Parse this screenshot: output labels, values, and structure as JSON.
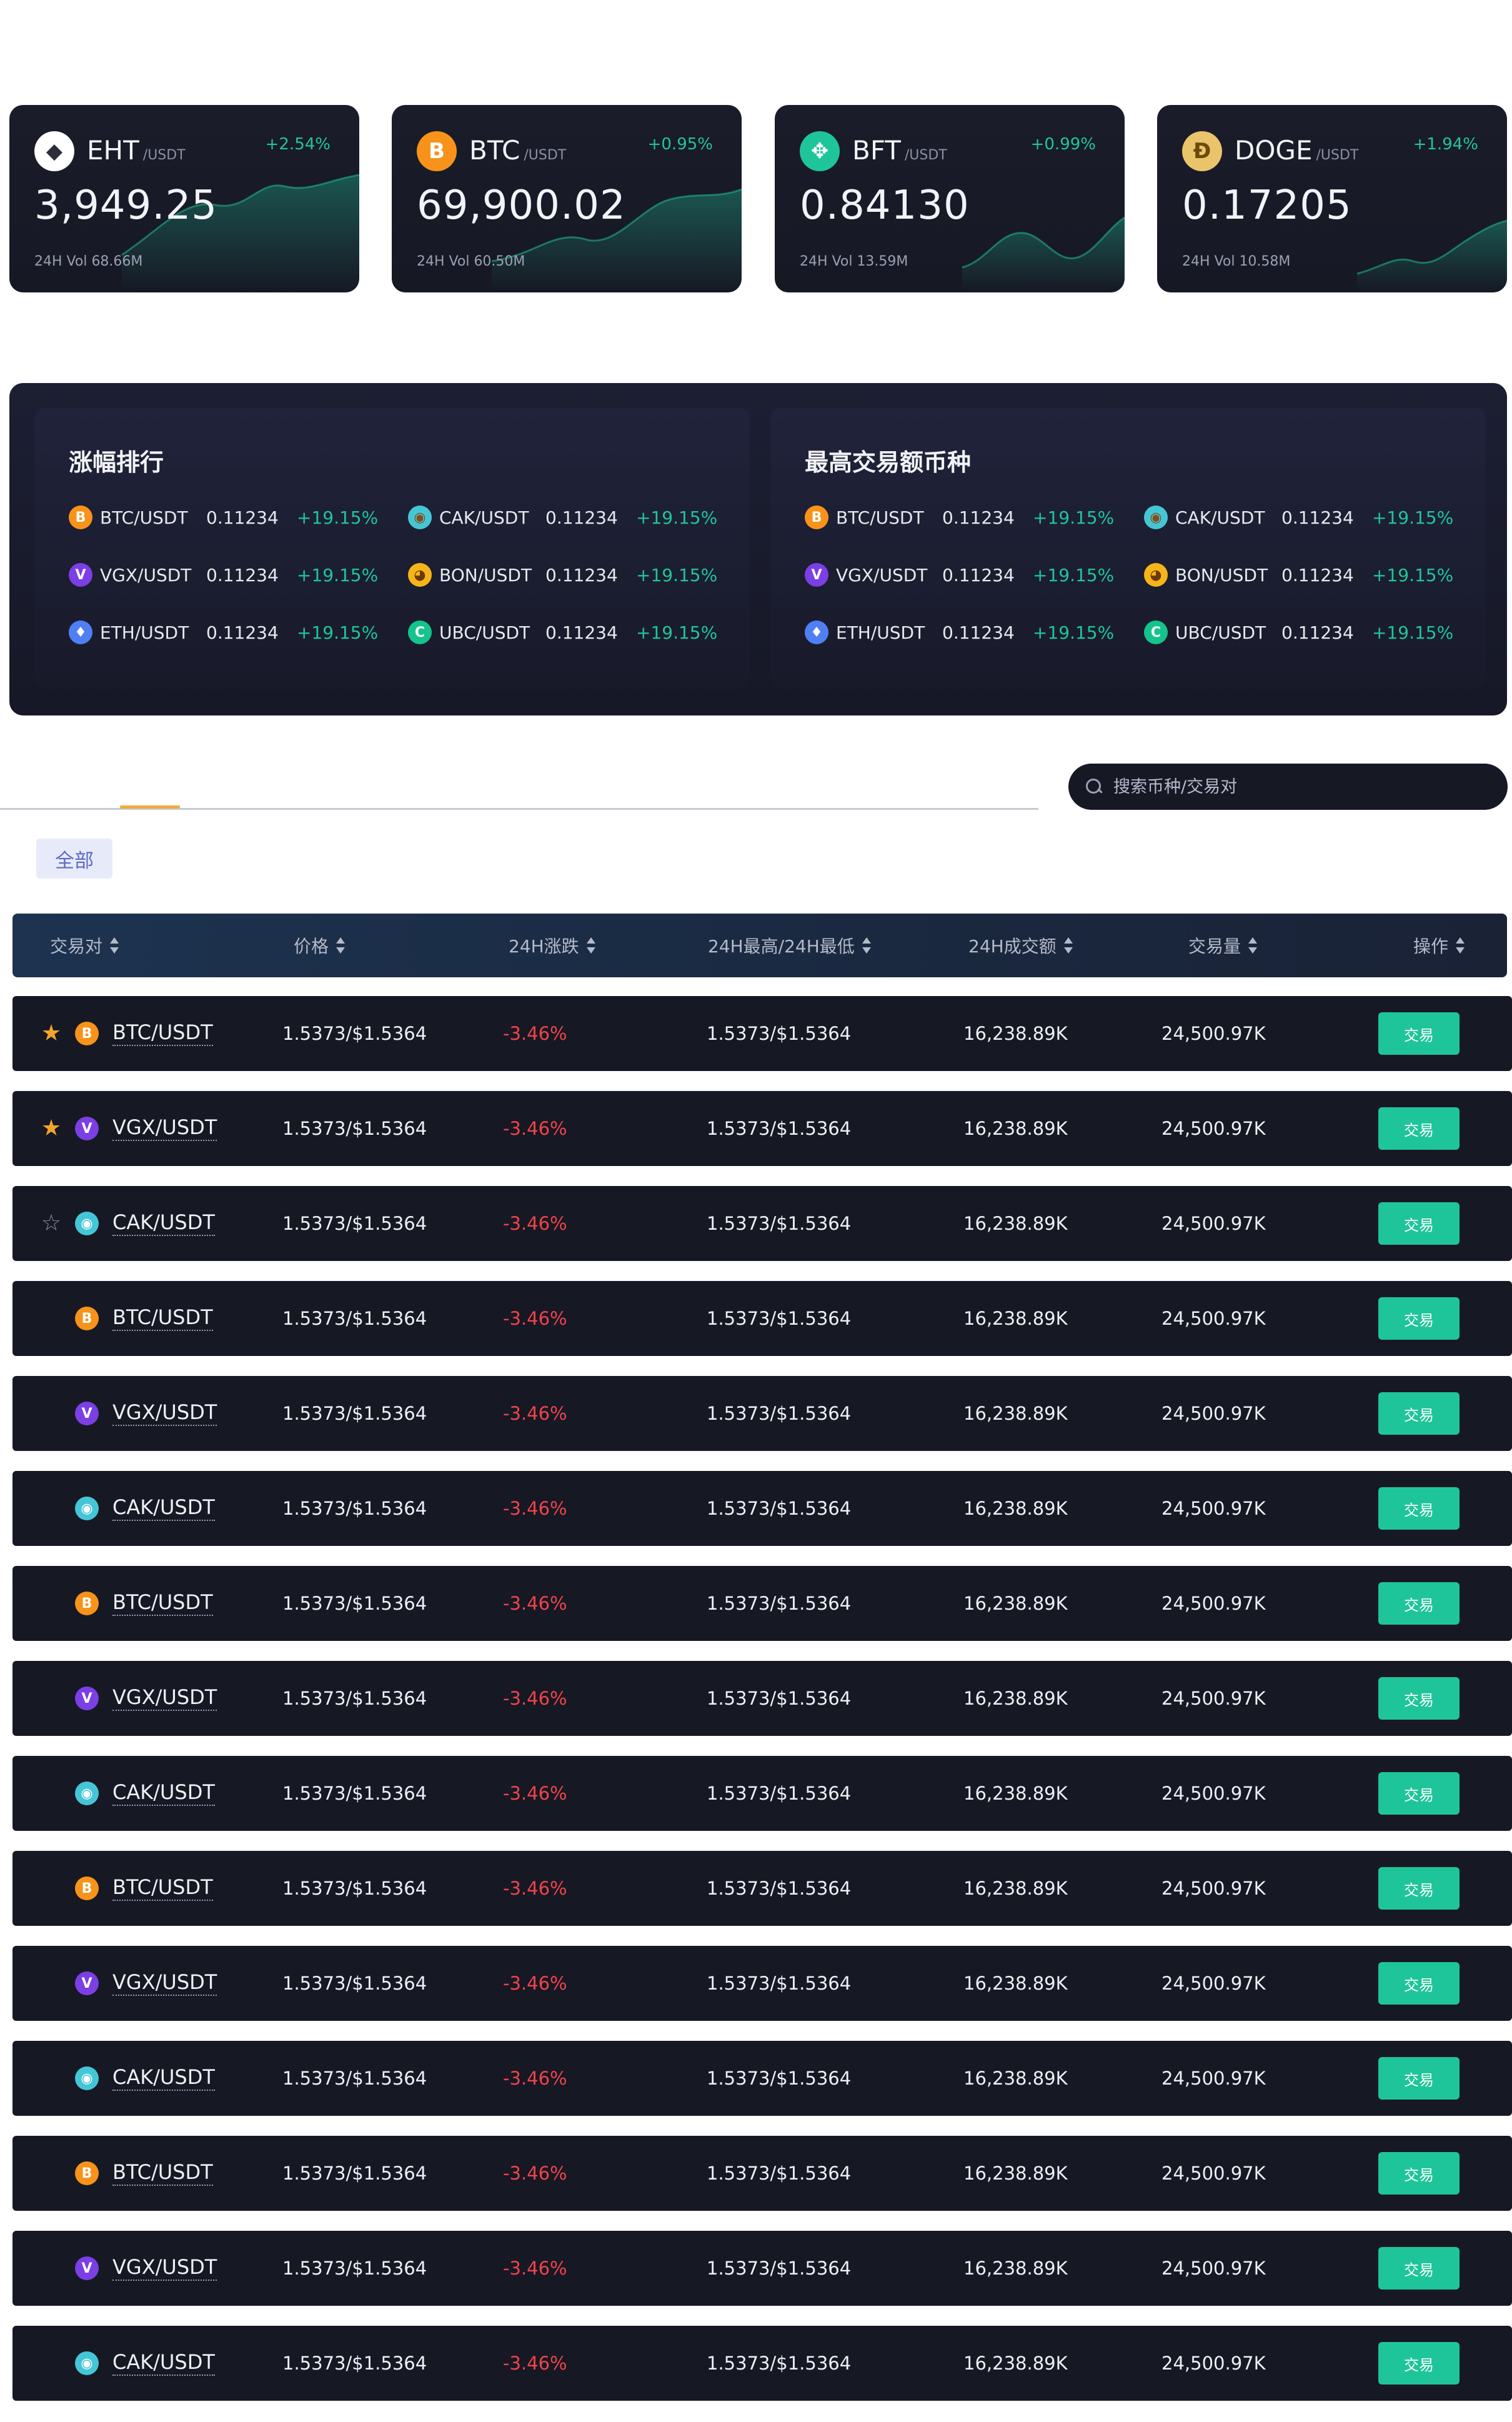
{
  "tickers": [
    {
      "symbol": "EHT",
      "quote": "/USDT",
      "change": "+2.54%",
      "price": "3,949.25",
      "volume": "24H Vol 68.66M",
      "icon": "ethereum-icon",
      "icon_glyph": "◆",
      "icon_bg": "#ffffff",
      "icon_fg": "#2b2d3a"
    },
    {
      "symbol": "BTC",
      "quote": "/USDT",
      "change": "+0.95%",
      "price": "69,900.02",
      "volume": "24H Vol 60.50M",
      "icon": "bitcoin-icon",
      "icon_glyph": "B",
      "icon_bg": "#f7931a",
      "icon_fg": "#ffffff"
    },
    {
      "symbol": "BFT",
      "quote": "/USDT",
      "change": "+0.99%",
      "price": "0.84130",
      "volume": "24H Vol 13.59M",
      "icon": "bft-icon",
      "icon_glyph": "✥",
      "icon_bg": "#1fc59a",
      "icon_fg": "#ffffff"
    },
    {
      "symbol": "DOGE",
      "quote": "/USDT",
      "change": "+1.94%",
      "price": "0.17205",
      "volume": "24H Vol 10.58M",
      "icon": "doge-icon",
      "icon_glyph": "Ð",
      "icon_bg": "#e9c46a",
      "icon_fg": "#6b4a0a"
    }
  ],
  "rankings": [
    {
      "title": "涨幅排行",
      "items": [
        {
          "pair": "BTC/USDT",
          "value": "0.11234",
          "change": "+19.15%",
          "coin": "btc",
          "glyph": "B"
        },
        {
          "pair": "CAK/USDT",
          "value": "0.11234",
          "change": "+19.15%",
          "coin": "cak",
          "glyph": "◉"
        },
        {
          "pair": "VGX/USDT",
          "value": "0.11234",
          "change": "+19.15%",
          "coin": "vgx",
          "glyph": "V"
        },
        {
          "pair": "BON/USDT",
          "value": "0.11234",
          "change": "+19.15%",
          "coin": "bon",
          "glyph": "◕"
        },
        {
          "pair": "ETH/USDT",
          "value": "0.11234",
          "change": "+19.15%",
          "coin": "eth",
          "glyph": "♦"
        },
        {
          "pair": "UBC/USDT",
          "value": "0.11234",
          "change": "+19.15%",
          "coin": "ubc",
          "glyph": "C"
        }
      ]
    },
    {
      "title": "最高交易额币种",
      "items": [
        {
          "pair": "BTC/USDT",
          "value": "0.11234",
          "change": "+19.15%",
          "coin": "btc",
          "glyph": "B"
        },
        {
          "pair": "CAK/USDT",
          "value": "0.11234",
          "change": "+19.15%",
          "coin": "cak",
          "glyph": "◉"
        },
        {
          "pair": "VGX/USDT",
          "value": "0.11234",
          "change": "+19.15%",
          "coin": "vgx",
          "glyph": "V"
        },
        {
          "pair": "BON/USDT",
          "value": "0.11234",
          "change": "+19.15%",
          "coin": "bon",
          "glyph": "◕"
        },
        {
          "pair": "ETH/USDT",
          "value": "0.11234",
          "change": "+19.15%",
          "coin": "eth",
          "glyph": "♦"
        },
        {
          "pair": "UBC/USDT",
          "value": "0.11234",
          "change": "+19.15%",
          "coin": "ubc",
          "glyph": "C"
        }
      ]
    }
  ],
  "search": {
    "placeholder": "搜索币种/交易对"
  },
  "filter": {
    "all_label": "全部"
  },
  "table": {
    "headers": [
      "交易对",
      "价格",
      "24H涨跌",
      "24H最高/24H最低",
      "24H成交额",
      "交易量",
      "操作"
    ],
    "trade_label": "交易",
    "rows": [
      {
        "star": "filled",
        "coin": "btc",
        "glyph": "B",
        "pair": "BTC/USDT",
        "price": "1.5373/$1.5364",
        "change": "-3.46%",
        "high_low": "1.5373/$1.5364",
        "turnover": "16,238.89K",
        "volume": "24,500.97K"
      },
      {
        "star": "filled",
        "coin": "vgx",
        "glyph": "V",
        "pair": "VGX/USDT",
        "price": "1.5373/$1.5364",
        "change": "-3.46%",
        "high_low": "1.5373/$1.5364",
        "turnover": "16,238.89K",
        "volume": "24,500.97K"
      },
      {
        "star": "outline",
        "coin": "cak",
        "glyph": "◉",
        "pair": "CAK/USDT",
        "price": "1.5373/$1.5364",
        "change": "-3.46%",
        "high_low": "1.5373/$1.5364",
        "turnover": "16,238.89K",
        "volume": "24,500.97K"
      },
      {
        "star": "none",
        "coin": "btc",
        "glyph": "B",
        "pair": "BTC/USDT",
        "price": "1.5373/$1.5364",
        "change": "-3.46%",
        "high_low": "1.5373/$1.5364",
        "turnover": "16,238.89K",
        "volume": "24,500.97K"
      },
      {
        "star": "none",
        "coin": "vgx",
        "glyph": "V",
        "pair": "VGX/USDT",
        "price": "1.5373/$1.5364",
        "change": "-3.46%",
        "high_low": "1.5373/$1.5364",
        "turnover": "16,238.89K",
        "volume": "24,500.97K"
      },
      {
        "star": "none",
        "coin": "cak",
        "glyph": "◉",
        "pair": "CAK/USDT",
        "price": "1.5373/$1.5364",
        "change": "-3.46%",
        "high_low": "1.5373/$1.5364",
        "turnover": "16,238.89K",
        "volume": "24,500.97K"
      },
      {
        "star": "none",
        "coin": "btc",
        "glyph": "B",
        "pair": "BTC/USDT",
        "price": "1.5373/$1.5364",
        "change": "-3.46%",
        "high_low": "1.5373/$1.5364",
        "turnover": "16,238.89K",
        "volume": "24,500.97K"
      },
      {
        "star": "none",
        "coin": "vgx",
        "glyph": "V",
        "pair": "VGX/USDT",
        "price": "1.5373/$1.5364",
        "change": "-3.46%",
        "high_low": "1.5373/$1.5364",
        "turnover": "16,238.89K",
        "volume": "24,500.97K"
      },
      {
        "star": "none",
        "coin": "cak",
        "glyph": "◉",
        "pair": "CAK/USDT",
        "price": "1.5373/$1.5364",
        "change": "-3.46%",
        "high_low": "1.5373/$1.5364",
        "turnover": "16,238.89K",
        "volume": "24,500.97K"
      },
      {
        "star": "none",
        "coin": "btc",
        "glyph": "B",
        "pair": "BTC/USDT",
        "price": "1.5373/$1.5364",
        "change": "-3.46%",
        "high_low": "1.5373/$1.5364",
        "turnover": "16,238.89K",
        "volume": "24,500.97K"
      },
      {
        "star": "none",
        "coin": "vgx",
        "glyph": "V",
        "pair": "VGX/USDT",
        "price": "1.5373/$1.5364",
        "change": "-3.46%",
        "high_low": "1.5373/$1.5364",
        "turnover": "16,238.89K",
        "volume": "24,500.97K"
      },
      {
        "star": "none",
        "coin": "cak",
        "glyph": "◉",
        "pair": "CAK/USDT",
        "price": "1.5373/$1.5364",
        "change": "-3.46%",
        "high_low": "1.5373/$1.5364",
        "turnover": "16,238.89K",
        "volume": "24,500.97K"
      },
      {
        "star": "none",
        "coin": "btc",
        "glyph": "B",
        "pair": "BTC/USDT",
        "price": "1.5373/$1.5364",
        "change": "-3.46%",
        "high_low": "1.5373/$1.5364",
        "turnover": "16,238.89K",
        "volume": "24,500.97K"
      },
      {
        "star": "none",
        "coin": "vgx",
        "glyph": "V",
        "pair": "VGX/USDT",
        "price": "1.5373/$1.5364",
        "change": "-3.46%",
        "high_low": "1.5373/$1.5364",
        "turnover": "16,238.89K",
        "volume": "24,500.97K"
      },
      {
        "star": "none",
        "coin": "cak",
        "glyph": "◉",
        "pair": "CAK/USDT",
        "price": "1.5373/$1.5364",
        "change": "-3.46%",
        "high_low": "1.5373/$1.5364",
        "turnover": "16,238.89K",
        "volume": "24,500.97K"
      }
    ]
  },
  "colors": {
    "up": "#1fc59a",
    "down": "#f0434a",
    "card_bg": "#161824",
    "star": "#f2a42b",
    "accent_tab": "#f3a93d"
  }
}
